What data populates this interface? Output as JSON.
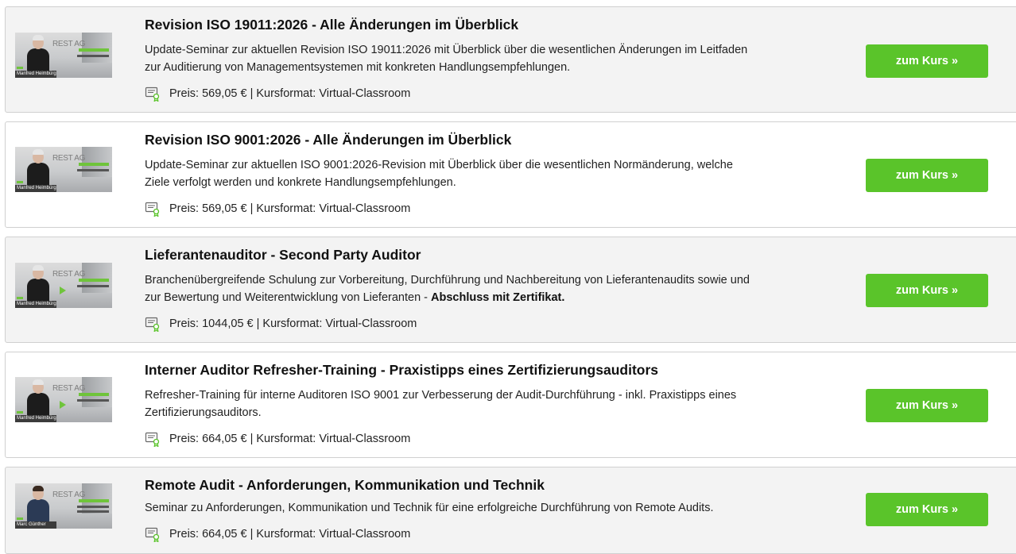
{
  "courses": [
    {
      "title": "Revision ISO 19011:2026 - Alle Änderungen im Überblick",
      "description_lines": [
        "Update-Seminar zur aktuellen Revision ISO 19011:2026 mit Überblick über die wesentlichen Änderungen im Leitfaden",
        "zur Auditierung von Managementsystemen mit konkreten Handlungsempfehlungen."
      ],
      "description_bold": "",
      "meta": "Preis: 569,05 € | Kursformat: Virtual-Classroom",
      "button": "zum Kurs »",
      "thumb_brand": "REST AG",
      "thumb_name": "Manfred Heimbürger"
    },
    {
      "title": "Revision ISO 9001:2026 - Alle Änderungen im Überblick",
      "description_lines": [
        "Update-Seminar zur aktuellen ISO 9001:2026-Revision mit Überblick über die wesentlichen Normänderung, welche",
        "Ziele verfolgt werden und konkrete Handlungsempfehlungen."
      ],
      "description_bold": "",
      "meta": "Preis: 569,05 € | Kursformat: Virtual-Classroom",
      "button": "zum Kurs »",
      "thumb_brand": "REST AG",
      "thumb_name": "Manfred Heimbürger"
    },
    {
      "title": "Lieferantenauditor - Second Party Auditor",
      "description_lines": [
        "Branchenübergreifende Schulung zur Vorbereitung, Durchführung und Nachbereitung von Lieferantenaudits sowie und",
        "zur Bewertung und Weiterentwicklung von Lieferanten - "
      ],
      "description_bold": "Abschluss mit Zertifikat.",
      "meta": "Preis: 1044,05 € | Kursformat: Virtual-Classroom",
      "button": "zum Kurs »",
      "thumb_brand": "REST AG",
      "thumb_name": "Manfred Heimbürger"
    },
    {
      "title": "Interner Auditor Refresher-Training - Praxistipps eines Zertifizierungsauditors",
      "description_lines": [
        "Refresher-Training für interne Auditoren ISO 9001 zur Verbesserung der Audit-Durchführung - inkl. Praxistipps eines",
        "Zertifizierungsauditors."
      ],
      "description_bold": "",
      "meta": "Preis: 664,05 € | Kursformat: Virtual-Classroom",
      "button": "zum Kurs »",
      "thumb_brand": "REST AG",
      "thumb_name": "Manfred Heimbürger"
    },
    {
      "title": "Remote Audit - Anforderungen, Kommunikation und Technik",
      "description_lines": [
        "Seminar zu Anforderungen, Kommunikation und Technik für eine erfolgreiche Durchführung von Remote Audits."
      ],
      "description_bold": "",
      "meta": "Preis: 664,05 € | Kursformat: Virtual-Classroom",
      "button": "zum Kurs »",
      "thumb_brand": "REST AG",
      "thumb_name": "Marc Günther"
    }
  ],
  "colors": {
    "button_green": "#5ac42a",
    "card_shaded": "#f3f3f3",
    "border": "#d0d0d0"
  },
  "icons": {
    "meta": "certificate-icon",
    "thumbnail": "video-thumbnail",
    "play": "play-icon"
  }
}
